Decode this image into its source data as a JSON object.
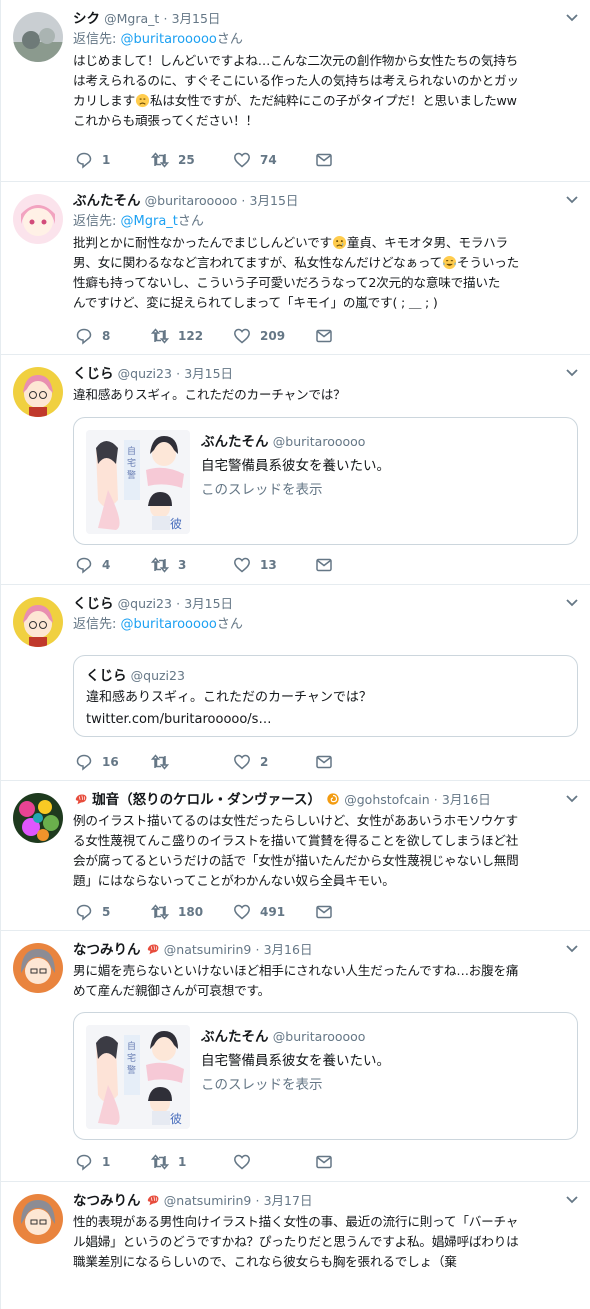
{
  "tweets": [
    {
      "name": "シク",
      "handle": "@Mgra_t",
      "date": "3月15日",
      "reply_label": "返信先:",
      "reply_mention": "@buritarooooo",
      "reply_suffix": "さん",
      "lines": [
        "はじめまして！しんどいですよね…こんな二次元の創作物から女性たちの気持ち",
        "は考えられるのに、すぐそこにいる作った人の気持ちは考えられないのかとガッ",
        "カリします",
        "私は女性ですが、ただ純粋にこの子がタイプだ！と思いましたww",
        "これからも頑張ってください！！"
      ],
      "replies": "1",
      "retweets": "25",
      "likes": "74",
      "avatar_color": "#9aa5a0"
    },
    {
      "name": "ぶんたそん",
      "handle": "@buritarooooo",
      "date": "3月15日",
      "reply_label": "返信先:",
      "reply_mention": "@Mgra_t",
      "reply_suffix": "さん",
      "lines": [
        "批判とかに耐性なかったんでまじしんどいです",
        "童貞、キモオタ男、モラハラ",
        "男、女に関わるななど言われてますが、私女性なんだけどなぁって",
        "そういった",
        "性癖も持ってないし、こういう子可愛いだろうなって2次元的な意味で描いた",
        "んですけど、変に捉えられてしまって「キモイ」の嵐です( ; ＿ ; )"
      ],
      "replies": "8",
      "retweets": "122",
      "likes": "209",
      "avatar_color": "#f4c7d8"
    },
    {
      "name": "くじら",
      "handle": "@quzi23",
      "date": "3月15日",
      "lines": [
        "違和感ありスギィ。これただのカーチャンでは？"
      ],
      "card": {
        "name": "ぶんたそん",
        "handle": "@buritarooooo",
        "text": "自宅警備員系彼女を養いたい。",
        "show": "このスレッドを表示"
      },
      "replies": "4",
      "retweets": "3",
      "likes": "13",
      "avatar_color": "#e8c23a"
    },
    {
      "name": "くじら",
      "handle": "@quzi23",
      "date": "3月15日",
      "reply_label": "返信先:",
      "reply_mention": "@buritarooooo",
      "reply_suffix": "さん",
      "quote": {
        "name": "くじら",
        "handle": "@quzi23",
        "text": "違和感ありスギィ。これただのカーチャンでは？",
        "link": "twitter.com/buritarooooo/s…"
      },
      "replies": "16",
      "retweets": "",
      "likes": "2",
      "avatar_color": "#e8c23a"
    },
    {
      "name": "珈音（怒りのケロル・ダンヴァース）",
      "handle": "@gohstofcain",
      "date": "3月16日",
      "lines": [
        "例のイラスト描いてるのは女性だったらしいけど、女性がああいうホモソウケす",
        "る女性蔑視てんこ盛りのイラストを描いて賞賛を得ることを欲してしまうほど社",
        "会が腐ってるというだけの話で「女性が描いたんだから女性蔑視じゃないし無問",
        "題」にはならないってことがわかんない奴ら全員キモい。"
      ],
      "replies": "5",
      "retweets": "180",
      "likes": "491",
      "avatar_color": "#3a8f3a"
    },
    {
      "name": "なつみりん",
      "handle": "@natsumirin9",
      "date": "3月16日",
      "lines": [
        "男に媚を売らないといけないほど相手にされない人生だったんですね…お腹を痛",
        "めて産んだ親御さんが可哀想です。"
      ],
      "card": {
        "name": "ぶんたそん",
        "handle": "@buritarooooo",
        "text": "自宅警備員系彼女を養いたい。",
        "show": "このスレッドを表示"
      },
      "replies": "1",
      "retweets": "1",
      "likes": "",
      "avatar_color": "#d9733a"
    },
    {
      "name": "なつみりん",
      "handle": "@natsumirin9",
      "date": "3月17日",
      "lines": [
        "性的表現がある男性向けイラスト描く女性の事、最近の流行に則って「バーチャ",
        "ル娼婦」というのどうですかね？ぴったりだと思うんですよ私。娼婦呼ばわりは",
        "職業差別になるらしいので、これなら彼女らも胸を張れるでしょ（棄"
      ],
      "avatar_color": "#d9733a"
    }
  ],
  "icons": {
    "reply": "reply-icon",
    "retweet": "retweet-icon",
    "like": "heart-icon",
    "dm": "envelope-icon",
    "more": "chevron-down-icon"
  },
  "colors": {
    "link": "#1da1f2",
    "muted": "#657786",
    "border": "#e6ecf0"
  }
}
